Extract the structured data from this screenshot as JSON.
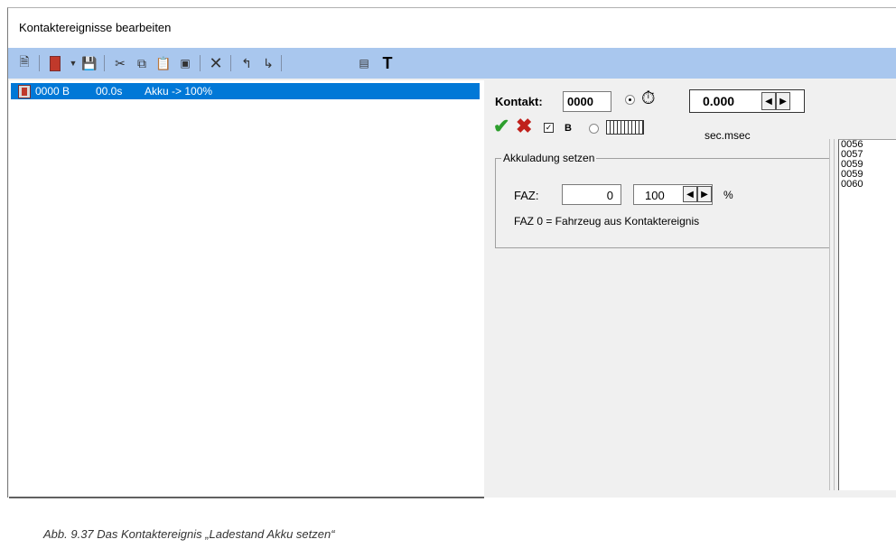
{
  "window": {
    "title": "Kontaktereignisse bearbeiten"
  },
  "toolbar": {
    "icons": [
      "new-document-icon",
      "battery-insert-icon",
      "dropdown-arrow-icon",
      "save-icon",
      "cut-icon",
      "copy-icon",
      "paste-icon",
      "paste-special-icon",
      "delete-icon",
      "move-up-icon",
      "move-down-icon",
      "table-icon",
      "text-tool-icon"
    ],
    "accent_color": "#a9c7ee"
  },
  "event_list": {
    "rows": [
      {
        "contact": "0000 B",
        "time": "00.0s",
        "action": "Akku -> 100%",
        "selected": true
      }
    ],
    "selection_color": "#0078d7"
  },
  "editor": {
    "kontakt_label": "Kontakt:",
    "kontakt_value": "0000",
    "time_value": "0.000",
    "time_unit": "sec.msec",
    "b_label": "B",
    "b_checked": true,
    "mode_timer_selected": true
  },
  "group": {
    "title": "Akkuladung setzen",
    "faz_label": "FAZ:",
    "faz_value": "0",
    "percent_value": "100",
    "percent_unit": "%",
    "hint": "FAZ 0 = Fahrzeug aus Kontaktereignis"
  },
  "number_list": [
    "0056",
    "0057",
    "0059",
    "0059",
    "0060"
  ],
  "caption": "Abb. 9.37    Das Kontaktereignis „Ladestand Akku setzen“"
}
